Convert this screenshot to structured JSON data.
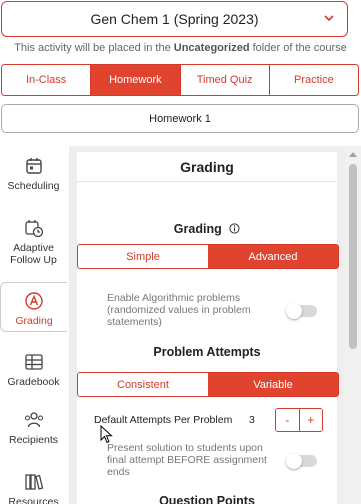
{
  "course_selector": {
    "value": "Gen Chem 1 (Spring 2023)",
    "icon": "chevron-down-icon"
  },
  "placement_note": {
    "prefix": "This activity will be placed in the",
    "folder": "Uncategorized",
    "suffix": "folder of the course"
  },
  "activity_types": [
    {
      "label": "In-Class",
      "active": false
    },
    {
      "label": "Homework",
      "active": true
    },
    {
      "label": "Timed Quiz",
      "active": false
    },
    {
      "label": "Practice",
      "active": false
    }
  ],
  "activity_selector": {
    "value": "Homework 1"
  },
  "sidebar": {
    "items": [
      {
        "label": "Scheduling",
        "icon": "calendar-icon",
        "active": false
      },
      {
        "label": "Adaptive Follow Up",
        "icon": "clock-calendar-icon",
        "active": false
      },
      {
        "label": "Grading",
        "icon": "grade-a-icon",
        "active": true
      },
      {
        "label": "Gradebook",
        "icon": "table-icon",
        "active": false
      },
      {
        "label": "Recipients",
        "icon": "people-icon",
        "active": false
      },
      {
        "label": "Resources",
        "icon": "books-icon",
        "active": false
      }
    ]
  },
  "panel": {
    "title": "Grading",
    "grading": {
      "label": "Grading",
      "options": [
        {
          "label": "Simple",
          "active": false
        },
        {
          "label": "Advanced",
          "active": true
        }
      ]
    },
    "algorithmic": {
      "label": "Enable Algorithmic problems (randomized values in problem statements)",
      "enabled": false
    },
    "problem_attempts": {
      "label": "Problem Attempts",
      "options": [
        {
          "label": "Consistent",
          "active": false
        },
        {
          "label": "Variable",
          "active": true
        }
      ],
      "default_label": "Default Attempts Per Problem",
      "default_value": "3",
      "minus": "-",
      "plus": "+"
    },
    "present_solution": {
      "label": "Present solution to students upon final attempt BEFORE assignment ends",
      "enabled": false
    },
    "next_section": "Question Points"
  },
  "colors": {
    "accent": "#e0442f",
    "border": "#d33a2c",
    "panel_bg": "#eeeeee"
  }
}
